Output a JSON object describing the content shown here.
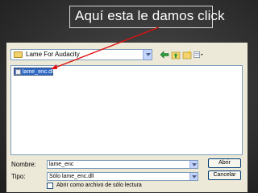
{
  "caption": {
    "text": "Aquí esta le damos click"
  },
  "toolbar": {
    "look_in": "Lame For Audacity",
    "icons": [
      "back-arrow-icon",
      "up-folder-icon",
      "new-folder-icon",
      "view-menu-icon"
    ]
  },
  "file_list": {
    "items": [
      {
        "name": "lame_enc.dll",
        "selected": true
      }
    ]
  },
  "form": {
    "name_label": "Nombre:",
    "name_value": "lame_enc",
    "type_label": "Tipo:",
    "type_value": "Sólo lame_enc.dll",
    "readonly_label": "Abrir como archivo de sólo lectura"
  },
  "buttons": {
    "open": "Abrir",
    "cancel": "Cancelar"
  },
  "colors": {
    "dialog_bg": "#ece9d8",
    "selection": "#316ac5",
    "annotation_arrow": "#e01010"
  }
}
